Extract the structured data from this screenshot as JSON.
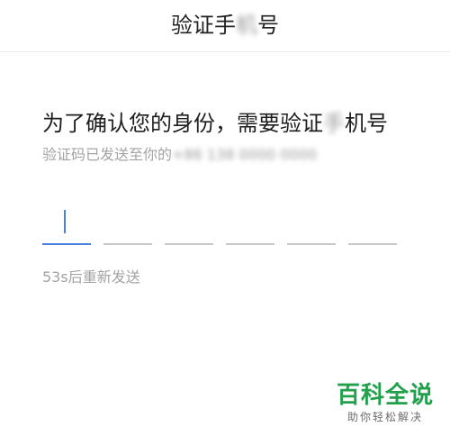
{
  "nav": {
    "title_prefix": "验证手",
    "title_blurred": "机",
    "title_suffix": "号"
  },
  "heading": {
    "prefix": "为了确认您的身份，需要验证",
    "blurred": "手",
    "suffix": "机号"
  },
  "subtext": {
    "prefix": "验证码已发送至你的",
    "blurred_number": "+86 138 0000 0000"
  },
  "code_inputs": {
    "count": 6,
    "active_index": 0,
    "accent_color": "#4a7fe0"
  },
  "resend": {
    "text": "53s后重新发送"
  },
  "watermark": {
    "main": "百科全说",
    "sub": "助你轻松解决",
    "color": "#22a04b"
  }
}
